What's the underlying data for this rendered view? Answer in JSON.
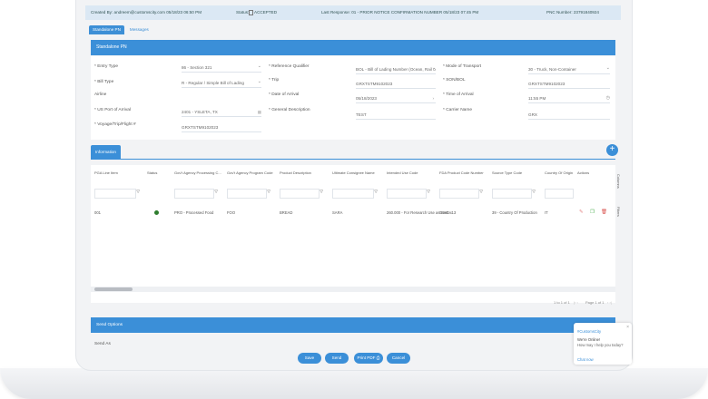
{
  "topbar": {
    "created_by": "Created By: andreem@customscity.com 05/18/23 06:50 PM",
    "status_label": "Status:",
    "status_value": "ACCEPTED",
    "last_response": "Last Response: 01 - PRIOR NOTICE CONFIRMATION NUMBER 05/18/23 07:45 PM",
    "pnc_number": "PNC Number: 23791840924"
  },
  "tabs": [
    "Standalone PN",
    "Messages"
  ],
  "panel_title": "Standalone PN",
  "form": {
    "entry_type": {
      "label": "Entry Type",
      "value": "86 - Section 321"
    },
    "bill_type": {
      "label": "Bill Type",
      "value": "R - Regular / Simple Bill of Lading"
    },
    "airline": {
      "label": "Airline"
    },
    "us_port": {
      "label": "US Port of Arrival",
      "value": "2401 - YSLETA, TX"
    },
    "voyage": {
      "label": "Voyage/Trip/Flight #",
      "value": "GRXTSTM9102023"
    },
    "reference_qualifier": {
      "label": "Reference Qualifier",
      "value": "BOL - Bill of Lading Number (Ocean, Rail or ..."
    },
    "trip": {
      "label": "Trip",
      "value": "GRXTSTM9102023"
    },
    "date_of_arrival": {
      "label": "Date of Arrival",
      "value": "05/18/2023"
    },
    "general_description": {
      "label": "General Description",
      "value": "TEST"
    },
    "mode_of_transport": {
      "label": "Mode of Transport",
      "value": "30 - Truck, Non-Container"
    },
    "son_bol": {
      "label": "SON/BOL",
      "value": "GRXTSTM9102023"
    },
    "time_of_arrival": {
      "label": "Time of Arrival",
      "value": "11:55 PM"
    },
    "carrier_name": {
      "label": "Carrier Name",
      "value": "GRX"
    }
  },
  "information_tab": "Information",
  "grid": {
    "headers": [
      "PGA Line Item",
      "Status",
      "Gov't Agency Processing C...",
      "Gov't Agency Program Code",
      "Product Description",
      "Ultimate Consignee Name",
      "Intended Use Code",
      "FDA Product Code Number",
      "Source Type Code",
      "Country Of Origin",
      "Actions"
    ],
    "row": {
      "line_item": "001",
      "processing": "PRO - Processed Food",
      "program": "FOO",
      "description": "BREAD",
      "consignee": "SARA",
      "intended_use": "260.000 - For Research Use as Hum...",
      "fda_code": "03ACH13",
      "source_type": "39 - Country Of Production",
      "country": "IT"
    },
    "side_tabs": [
      "Columns",
      "Filters"
    ],
    "pager_range": "1 to 1 of 1",
    "pager_page": "Page 1 of 1"
  },
  "send_options": "Send Options",
  "send_as": "Send As",
  "buttons": {
    "save": "Save",
    "send": "Send",
    "print": "Print PDF",
    "cancel": "Cancel"
  },
  "chat": {
    "title": "#CustomsCity",
    "online": "We're Online!",
    "help": "How may I help you today?",
    "chat_now": "Chat now"
  },
  "colors": {
    "primary": "#3b8fd8",
    "status_ok": "#2e7d2e",
    "delete": "#d9534f",
    "copy": "#4caf50"
  }
}
